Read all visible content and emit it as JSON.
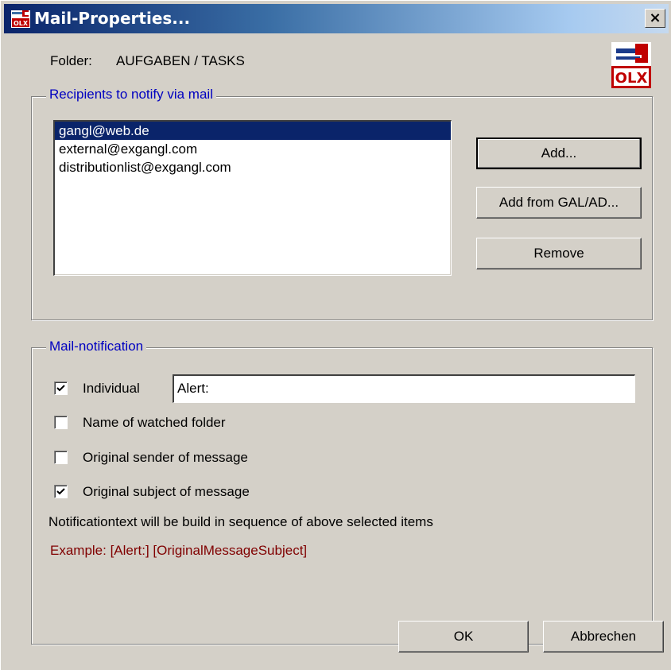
{
  "window": {
    "title": "Mail-Properties...",
    "close_label": "×"
  },
  "folder": {
    "label": "Folder:",
    "value": "AUFGABEN / TASKS"
  },
  "logo": {
    "text": "OLX",
    "icon": "olx-tools-logo"
  },
  "recipients": {
    "group_title": "Recipients to notify via mail",
    "items": [
      {
        "label": "gangl@web.de",
        "selected": true
      },
      {
        "label": "external@exgangl.com",
        "selected": false
      },
      {
        "label": "distributionlist@exgangl.com",
        "selected": false
      }
    ],
    "add_label": "Add...",
    "add_gal_label": "Add from GAL/AD...",
    "remove_label": "Remove"
  },
  "notification": {
    "group_title": "Mail-notification",
    "individual": {
      "label": "Individual",
      "checked": true,
      "value": "Alert:"
    },
    "watched_folder": {
      "label": "Name of watched folder",
      "checked": false
    },
    "original_sender": {
      "label": "Original sender of message",
      "checked": false
    },
    "original_subject": {
      "label": "Original subject of message",
      "checked": true
    },
    "info_text": "Notificationtext will be build in sequence of above selected items",
    "example_text": "Example: [Alert:] [OriginalMessageSubject]"
  },
  "footer": {
    "ok_label": "OK",
    "cancel_label": "Abbrechen"
  },
  "colors": {
    "title_start": "#0a246a",
    "title_end": "#a6caf0",
    "group_title": "#0000c0",
    "example": "#800000",
    "selection": "#0a246a"
  }
}
